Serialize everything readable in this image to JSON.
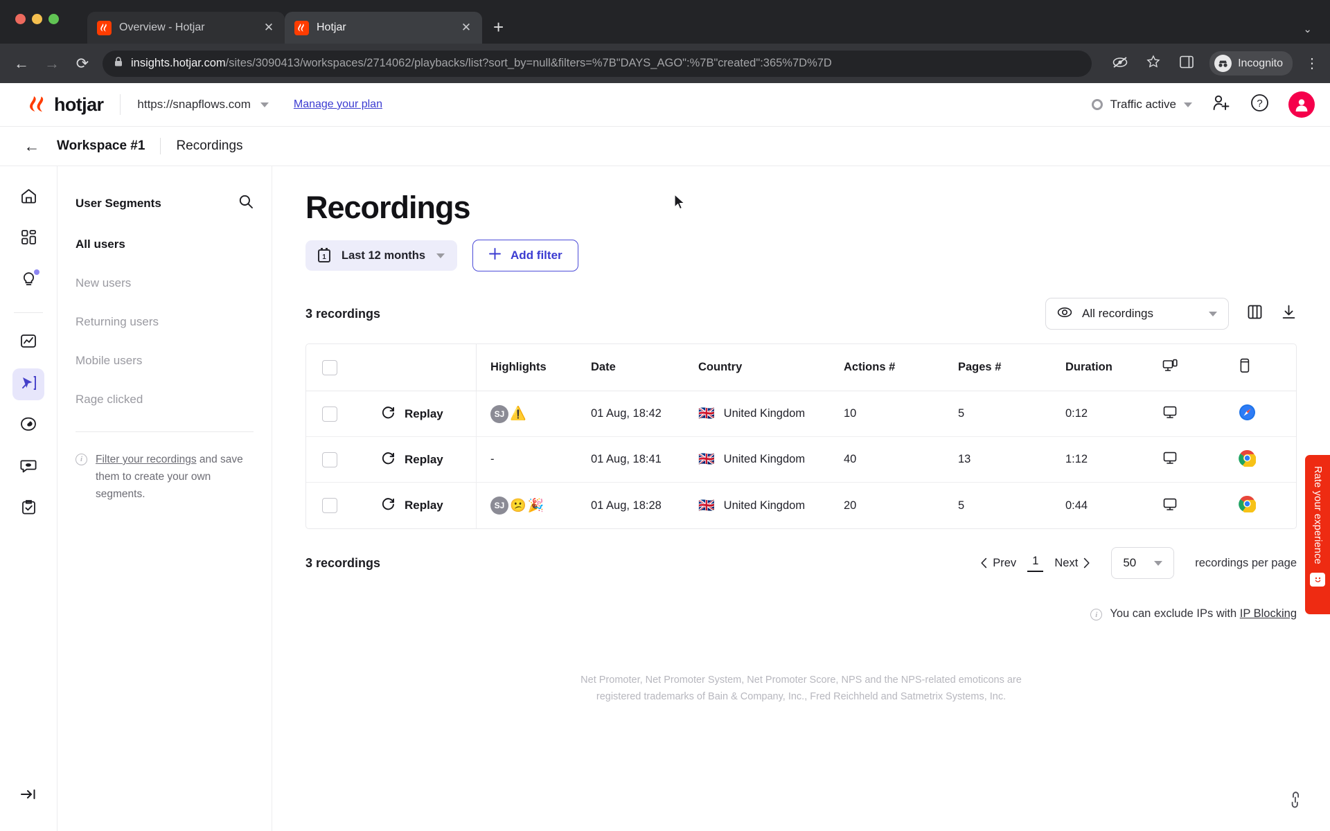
{
  "browser": {
    "tabs": [
      {
        "title": "Overview - Hotjar",
        "active": false,
        "favicon": "hotjar-icon",
        "close_label": "✕"
      },
      {
        "title": "Hotjar",
        "active": true,
        "favicon": "hotjar-icon",
        "close_label": "✕"
      }
    ],
    "new_tab_label": "+",
    "window_chevron": "⌄",
    "nav": {
      "back": "←",
      "forward": "→",
      "reload": "⟳"
    },
    "omnibox": {
      "lock": "ὑ2",
      "domain": "insights.hotjar.com",
      "path": "/sites/3090413/workspaces/2714062/playbacks/list?sort_by=null&filters=%7B\"DAYS_AGO\":%7B\"created\":365%7D%7D"
    },
    "incognito_label": "Incognito",
    "kebab_label": "⋮"
  },
  "appbar": {
    "logo_text": "hotjar",
    "site": "https://snapflows.com",
    "manage_plan": "Manage your plan",
    "traffic_status": "Traffic active",
    "invite_icon": "add-user-icon",
    "help_icon": "question-mark-icon",
    "avatar_icon": "user-avatar-icon"
  },
  "breadcrumb": {
    "back": "←",
    "workspace": "Workspace #1",
    "current": "Recordings"
  },
  "rail": {
    "items": [
      {
        "name": "home",
        "icon": "home-icon",
        "active": false,
        "badge": false
      },
      {
        "name": "dashboards",
        "icon": "dashboard-grid-icon",
        "active": false,
        "badge": false
      },
      {
        "name": "highlights",
        "icon": "lightbulb-icon",
        "active": false,
        "badge": true
      },
      {
        "name": "trends",
        "icon": "chart-line-icon",
        "active": false,
        "badge": false
      },
      {
        "name": "recordings",
        "icon": "recordings-cursor-icon",
        "active": true,
        "badge": false
      },
      {
        "name": "heatmaps",
        "icon": "heatmap-icon",
        "active": false,
        "badge": false
      },
      {
        "name": "feedback",
        "icon": "chat-bubble-icon",
        "active": false,
        "badge": false
      },
      {
        "name": "surveys",
        "icon": "clipboard-check-icon",
        "active": false,
        "badge": false
      }
    ],
    "collapse_icon": "collapse-sidebar-icon"
  },
  "segments": {
    "title": "User Segments",
    "search_icon": "search-icon",
    "items": [
      {
        "label": "All users",
        "active": true
      },
      {
        "label": "New users",
        "active": false
      },
      {
        "label": "Returning users",
        "active": false
      },
      {
        "label": "Mobile users",
        "active": false
      },
      {
        "label": "Rage clicked",
        "active": false
      }
    ],
    "note_link": "Filter your recordings",
    "note_rest": " and save them to create your own segments."
  },
  "main": {
    "title": "Recordings",
    "date_filter": "Last 12 months",
    "add_filter": "Add filter",
    "count_top": "3 recordings",
    "count_bottom": "3 recordings",
    "view_select": "All recordings",
    "columns_icon": "columns-icon",
    "download_icon": "download-icon",
    "table": {
      "headers": [
        "",
        "",
        "Highlights",
        "Date",
        "Country",
        "Actions #",
        "Pages #",
        "Duration",
        "device-icon",
        "browser-icon"
      ],
      "replay_label": "Replay",
      "rows": [
        {
          "highlight_initials": "SJ",
          "highlight_emojis": [
            "⚠️"
          ],
          "highlight_dash": "",
          "date": "01 Aug, 18:42",
          "country": "United Kingdom",
          "flag": "🇬🇧",
          "actions": "10",
          "pages": "5",
          "duration": "0:12",
          "device": "desktop-icon",
          "browser": "safari-icon"
        },
        {
          "highlight_initials": "",
          "highlight_emojis": [],
          "highlight_dash": "-",
          "date": "01 Aug, 18:41",
          "country": "United Kingdom",
          "flag": "🇬🇧",
          "actions": "40",
          "pages": "13",
          "duration": "1:12",
          "device": "desktop-icon",
          "browser": "chrome-icon"
        },
        {
          "highlight_initials": "SJ",
          "highlight_emojis": [
            "😕",
            "🎉"
          ],
          "highlight_dash": "",
          "date": "01 Aug, 18:28",
          "country": "United Kingdom",
          "flag": "🇬🇧",
          "actions": "20",
          "pages": "5",
          "duration": "0:44",
          "device": "desktop-icon",
          "browser": "chrome-icon"
        }
      ]
    },
    "pagination": {
      "prev": "Prev",
      "page": "1",
      "next": "Next",
      "per_page": "50",
      "per_page_label": "recordings per page"
    },
    "ip_note": "You can exclude IPs with ",
    "ip_link": "IP Blocking",
    "nps_line1": "Net Promoter, Net Promoter System, Net Promoter Score, NPS and the NPS-related emoticons are",
    "nps_line2": "registered trademarks of Bain & Company, Inc., Fred Reichheld and Satmetrix Systems, Inc."
  },
  "rate_widget": {
    "label": "Rate your experience",
    "icon": "smiley-face-icon"
  },
  "colors": {
    "brand_red": "#FF3C00",
    "accent_indigo": "#3B3BD1",
    "avatar_pink": "#F5004B",
    "rate_red": "#EE2B12"
  }
}
